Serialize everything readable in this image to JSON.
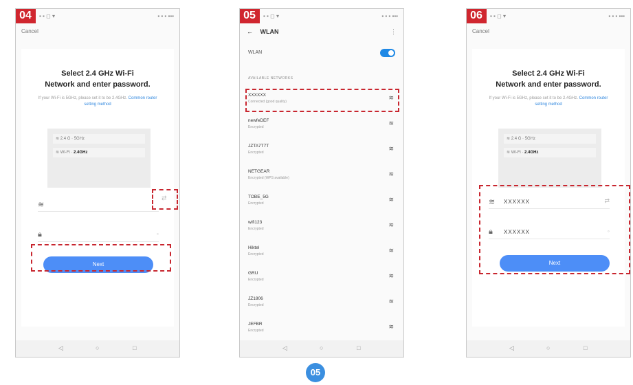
{
  "step_badges": [
    "04",
    "05",
    "06"
  ],
  "bottom_badge": "05",
  "status": {
    "left": "▪ ▪ ◻ ▾",
    "right": "▪ ▪ ▪ ▪▪▪"
  },
  "setup": {
    "cancel": "Cancel",
    "title_line1": "Select 2.4 GHz Wi-Fi",
    "title_line2": "Network and enter password.",
    "hint": "If your Wi-Fi is 5GHz, please set it to be 2.4GHz.",
    "hint_link": "Common router setting method",
    "mini_row1": "≋ 2.4 G · 5GHz",
    "mini_row2_label": "≋ Wi-Fi · ",
    "mini_row2_value": "2.4GHz",
    "next": "Next",
    "filled_ssid": "XXXXXX",
    "filled_password": "XXXXXX"
  },
  "wlan": {
    "title": "WLAN",
    "toggle_label": "WLAN",
    "section": "AVAILABLE NETWORKS",
    "networks": [
      {
        "ssid": "XXXXXX",
        "status": "Connected (good quality)"
      },
      {
        "ssid": "newfeDEF",
        "status": "Encrypted"
      },
      {
        "ssid": "JZTA7T7T",
        "status": "Encrypted"
      },
      {
        "ssid": "NETGEAR",
        "status": "Encrypted (WPS available)"
      },
      {
        "ssid": "TOBE_5G",
        "status": "Encrypted"
      },
      {
        "ssid": "wifi123",
        "status": "Encrypted"
      },
      {
        "ssid": "Hiktel",
        "status": "Encrypted"
      },
      {
        "ssid": "GRU",
        "status": "Encrypted"
      },
      {
        "ssid": "JZ1806",
        "status": "Encrypted"
      },
      {
        "ssid": "JEFBR",
        "status": "Encrypted"
      }
    ]
  },
  "nav_icons": [
    "◁",
    "○",
    "□"
  ],
  "colors": {
    "accent": "#4d8ef7",
    "badge": "#d0262f",
    "highlight": "#c8262f",
    "toggle": "#1e88e5"
  }
}
